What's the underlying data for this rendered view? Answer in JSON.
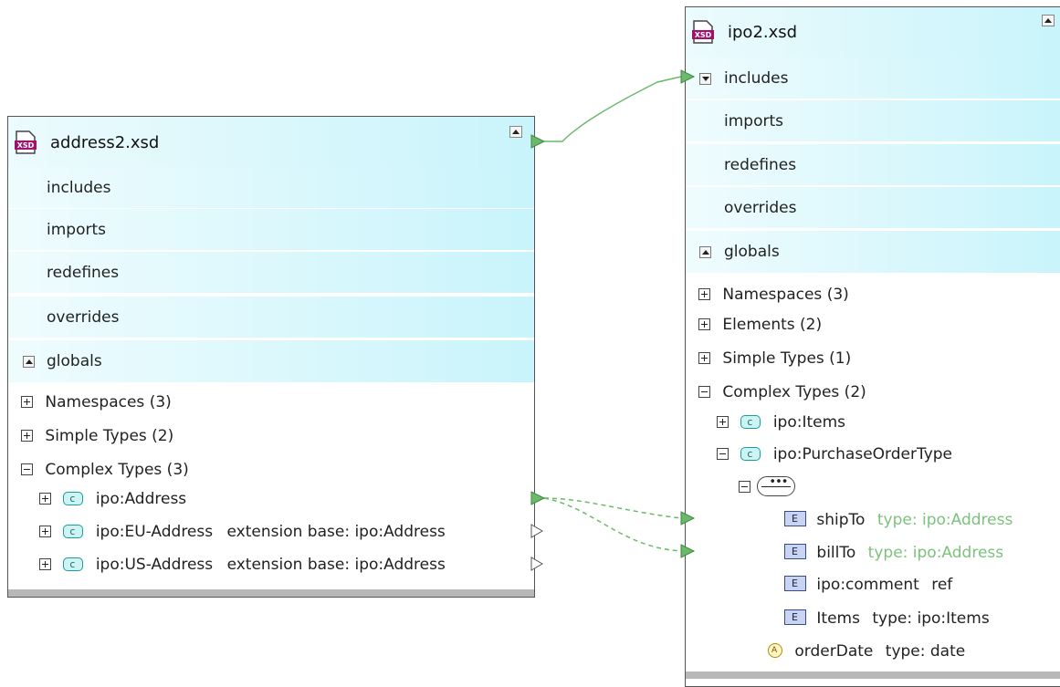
{
  "address_box": {
    "title": "address2.xsd",
    "sections": [
      "includes",
      "imports",
      "redefines",
      "overrides"
    ],
    "globals_label": "globals",
    "tree": {
      "namespaces": "Namespaces (3)",
      "simple_types": "Simple Types (2)",
      "complex_types": "Complex Types (3)",
      "types": [
        {
          "name": "ipo:Address",
          "extra": ""
        },
        {
          "name": "ipo:EU-Address",
          "extra": "extension base: ipo:Address"
        },
        {
          "name": "ipo:US-Address",
          "extra": "extension base: ipo:Address"
        }
      ]
    }
  },
  "ipo_box": {
    "title": "ipo2.xsd",
    "sections": [
      "includes",
      "imports",
      "redefines",
      "overrides"
    ],
    "globals_label": "globals",
    "tree": {
      "namespaces": "Namespaces (3)",
      "elements": "Elements (2)",
      "simple_types": "Simple Types (1)",
      "complex_types": "Complex Types (2)",
      "items": "ipo:Items",
      "purchase_order_type": "ipo:PurchaseOrderType",
      "children": [
        {
          "name": "shipTo",
          "type": "type: ipo:Address"
        },
        {
          "name": "billTo",
          "type": "type: ipo:Address"
        },
        {
          "name": "ipo:comment",
          "type": "ref"
        },
        {
          "name": "Items",
          "type": "type: ipo:Items"
        }
      ],
      "attribute": {
        "name": "orderDate",
        "type": "type: date"
      }
    }
  },
  "colors": {
    "header_light": "#ecfbfd",
    "header_cyan": "#c9f4fb",
    "connector_green": "#6cb86c"
  },
  "icons": [
    "xsd-file-icon",
    "collapse-icon",
    "expand-icon",
    "complex-type-icon",
    "element-icon",
    "attribute-icon",
    "sequence-icon",
    "connector-arrow-icon"
  ]
}
